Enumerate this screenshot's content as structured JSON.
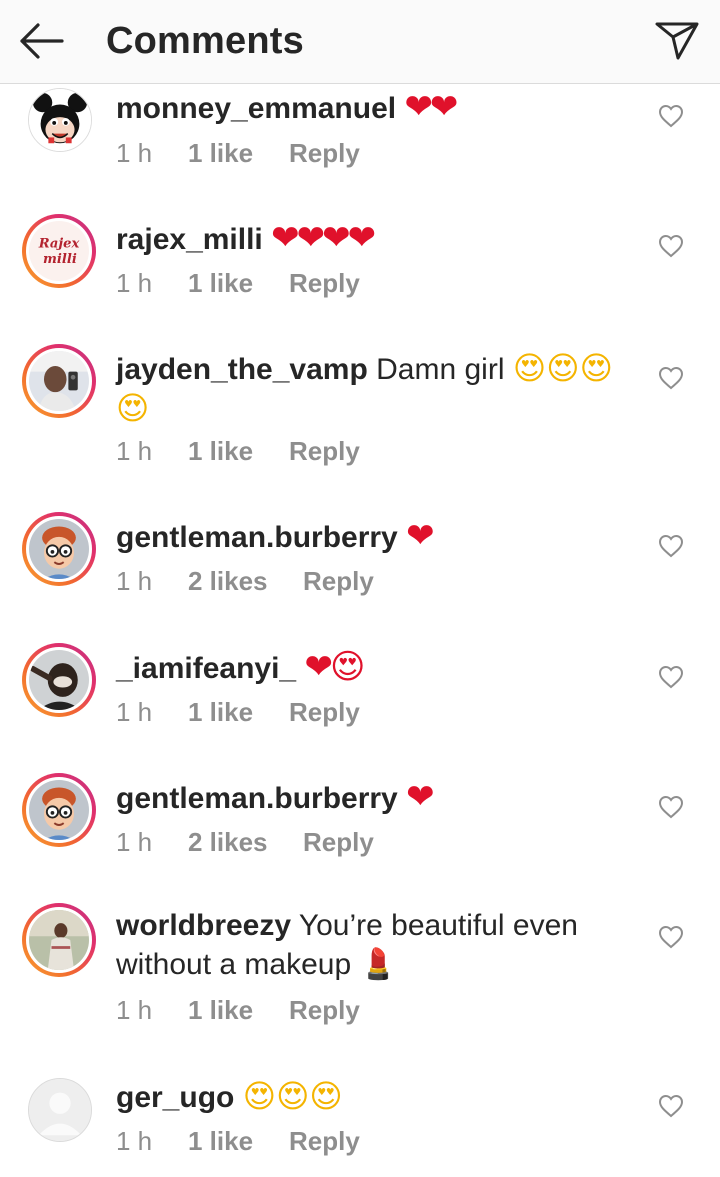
{
  "header": {
    "title": "Comments",
    "back_icon": "arrow-left-icon",
    "send_icon": "paper-plane-icon"
  },
  "colors": {
    "header_bg": "#fafafa",
    "text": "#262626",
    "meta": "#8e8e8e",
    "heart_emoji": "#e0112b",
    "story_ring": "#e1306c"
  },
  "reply_label": "Reply",
  "comments": [
    {
      "username": "monney_emmanuel",
      "text": "",
      "emoji": "❤❤",
      "time": "1 h",
      "likes": "1 like"
    },
    {
      "username": "rajex_milli",
      "text": "",
      "emoji": "❤❤❤❤",
      "time": "1 h",
      "likes": "1 like"
    },
    {
      "username": "jayden_the_vamp",
      "text": "Damn girl",
      "emoji": "😍😍😍😍",
      "time": "1 h",
      "likes": "1 like"
    },
    {
      "username": "gentleman.burberry",
      "text": "",
      "emoji": "❤",
      "time": "1 h",
      "likes": "2 likes"
    },
    {
      "username": "_iamifeanyi_",
      "text": "",
      "emoji": "❤😍",
      "time": "1 h",
      "likes": "1 like"
    },
    {
      "username": "gentleman.burberry",
      "text": "",
      "emoji": "❤",
      "time": "1 h",
      "likes": "2 likes"
    },
    {
      "username": "worldbreezy",
      "text": "You’re beautiful even without a makeup",
      "emoji": "💄",
      "time": "1 h",
      "likes": "1 like"
    },
    {
      "username": "ger_ugo",
      "text": "",
      "emoji": "😍😍😍",
      "time": "1 h",
      "likes": "1 like"
    }
  ],
  "avatar_labels": {
    "rajex_milli": [
      "Rajex",
      "milli"
    ]
  }
}
